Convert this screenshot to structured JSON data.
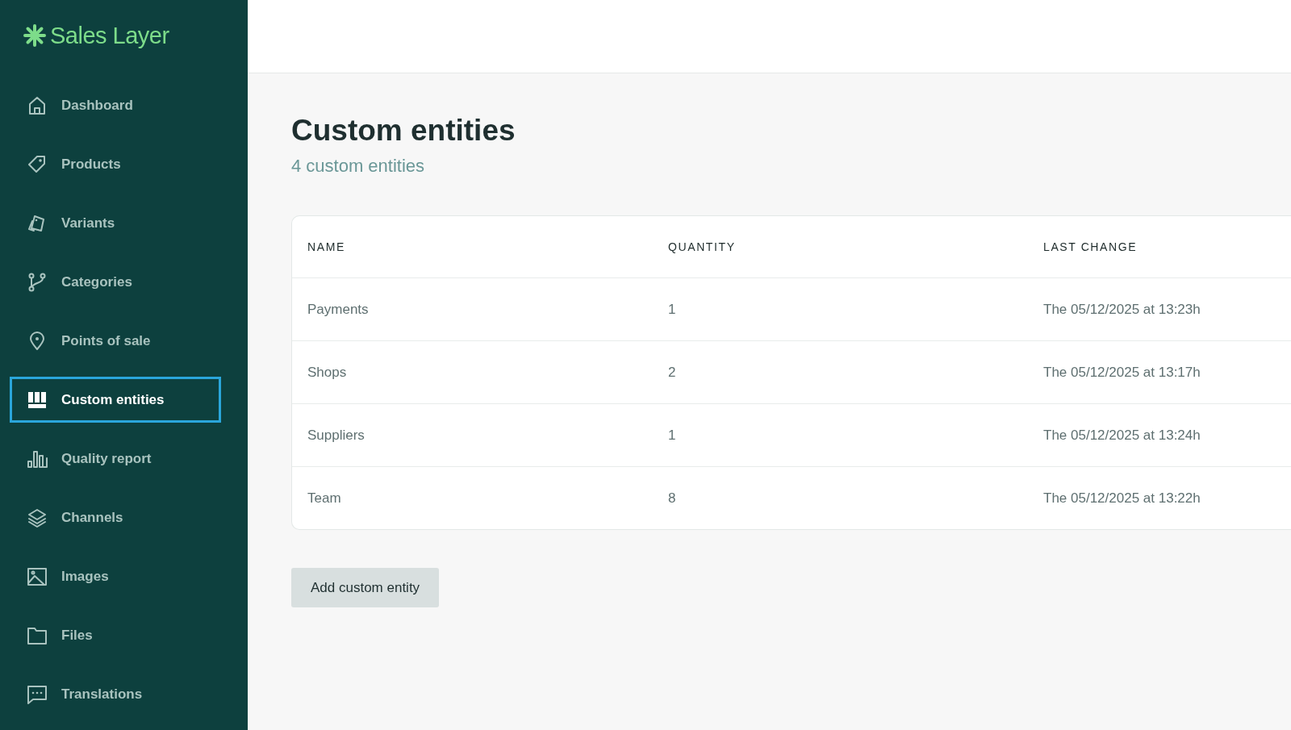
{
  "sidebar": {
    "logo": "Sales Layer",
    "items": [
      {
        "label": "Dashboard",
        "selected": false
      },
      {
        "label": "Products",
        "selected": false
      },
      {
        "label": "Variants",
        "selected": false
      },
      {
        "label": "Categories",
        "selected": false
      },
      {
        "label": "Points of sale",
        "selected": false
      },
      {
        "label": "Custom entities",
        "selected": true
      },
      {
        "label": "Quality report",
        "selected": false
      },
      {
        "label": "Channels",
        "selected": false
      },
      {
        "label": "Images",
        "selected": false
      },
      {
        "label": "Files",
        "selected": false
      },
      {
        "label": "Translations",
        "selected": false
      }
    ]
  },
  "page": {
    "title": "Custom entities",
    "subtitle": "4 custom entities"
  },
  "table": {
    "columns": [
      "NAME",
      "QUANTITY",
      "LAST CHANGE"
    ],
    "rows": [
      [
        "Payments",
        "1",
        "The 05/12/2025 at 13:23h"
      ],
      [
        "Shops",
        "2",
        "The 05/12/2025 at 13:17h"
      ],
      [
        "Suppliers",
        "1",
        "The 05/12/2025 at 13:24h"
      ],
      [
        "Team",
        "8",
        "The 05/12/2025 at 13:22h"
      ]
    ]
  },
  "add_button": "Add custom entity"
}
